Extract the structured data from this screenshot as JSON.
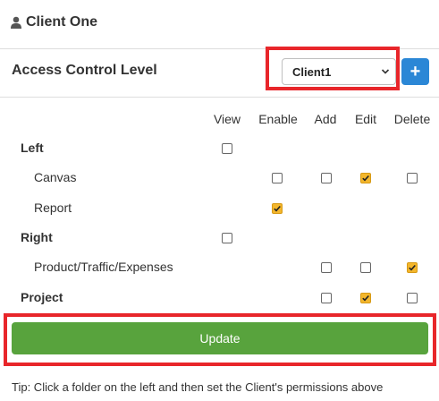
{
  "header": {
    "title": "Client One",
    "icon": "user-icon"
  },
  "acl": {
    "label": "Access Control Level",
    "select_value": "Client1",
    "add_button": "+"
  },
  "columns": [
    "View",
    "Enable",
    "Add",
    "Edit",
    "Delete"
  ],
  "rows": [
    {
      "label": "Left",
      "bold": true,
      "cells": {
        "View": false
      }
    },
    {
      "label": "Canvas",
      "bold": false,
      "cells": {
        "Enable": false,
        "Add": false,
        "Edit": true,
        "Delete": false
      }
    },
    {
      "label": "Report",
      "bold": false,
      "cells": {
        "Enable": true
      }
    },
    {
      "label": "Right",
      "bold": true,
      "cells": {
        "View": false
      }
    },
    {
      "label": "Product/Traffic/Expenses",
      "bold": false,
      "cells": {
        "Add": false,
        "Edit": false,
        "Delete": true
      }
    },
    {
      "label": "Project",
      "bold": true,
      "cells": {
        "Add": false,
        "Edit": true,
        "Delete": false
      }
    }
  ],
  "update_button": "Update",
  "tip": "Tip: Click a folder on the left and then set the Client's permissions above",
  "colors": {
    "accent_checkbox": "#f3b62c",
    "update": "#58a33d",
    "plus": "#2b87d6",
    "highlight": "#e8262a"
  }
}
